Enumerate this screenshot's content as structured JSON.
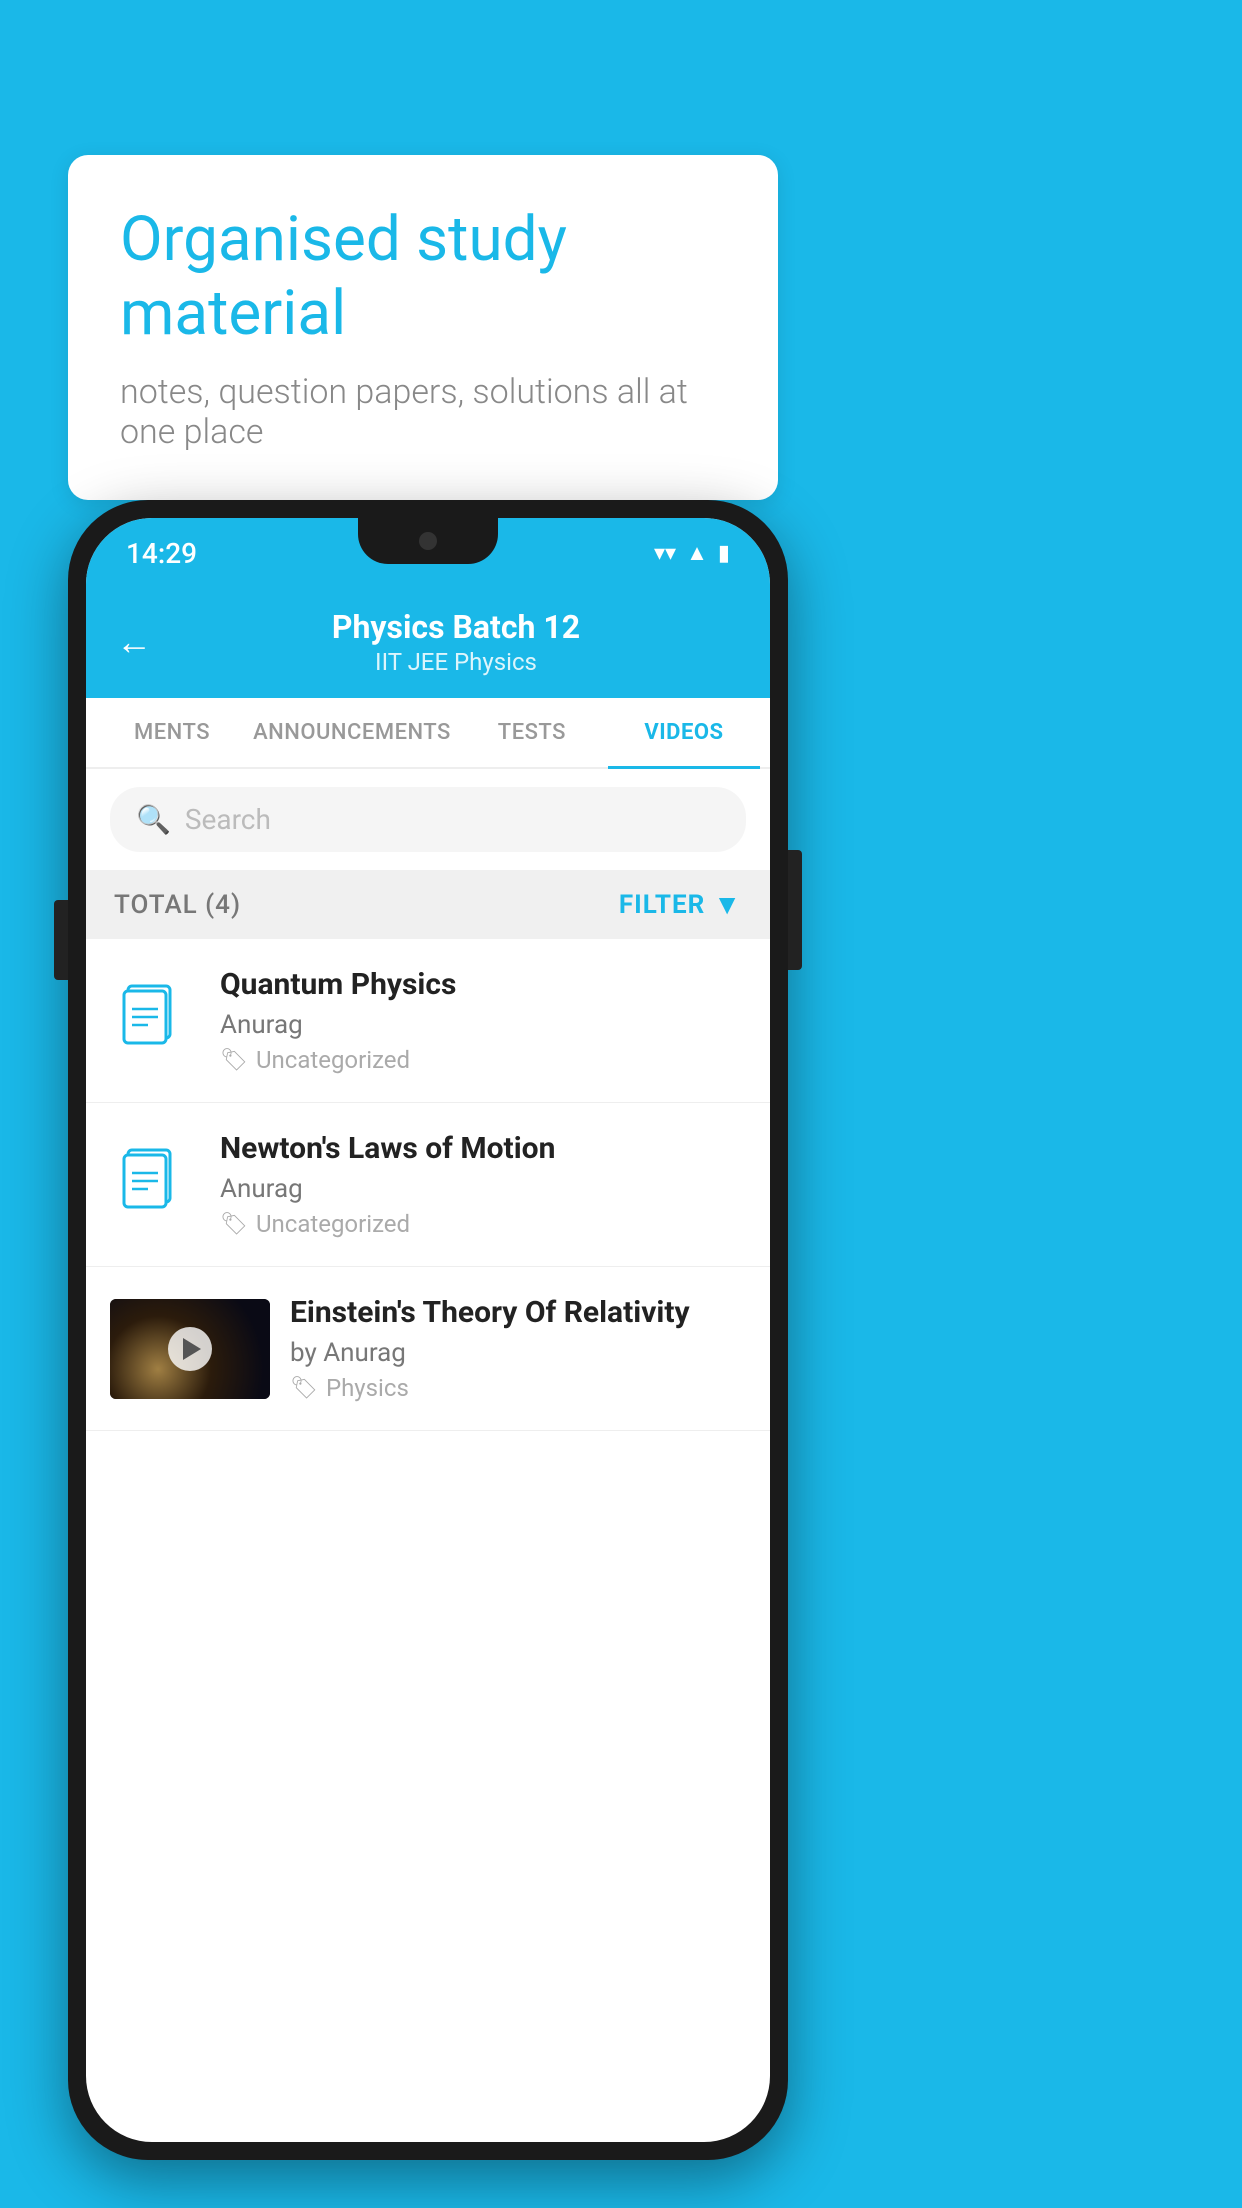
{
  "background_color": "#1ab8e8",
  "speech_bubble": {
    "headline": "Organised study material",
    "subtext": "notes, question papers, solutions all at one place"
  },
  "phone": {
    "status_bar": {
      "time": "14:29",
      "icons": [
        "wifi",
        "signal",
        "battery"
      ]
    },
    "header": {
      "back_label": "←",
      "title": "Physics Batch 12",
      "subtitle": "IIT JEE   Physics"
    },
    "tabs": [
      {
        "label": "MENTS",
        "active": false
      },
      {
        "label": "ANNOUNCEMENTS",
        "active": false
      },
      {
        "label": "TESTS",
        "active": false
      },
      {
        "label": "VIDEOS",
        "active": true
      }
    ],
    "search": {
      "placeholder": "Search"
    },
    "filter": {
      "total_label": "TOTAL (4)",
      "filter_label": "FILTER"
    },
    "videos": [
      {
        "id": 1,
        "title": "Quantum Physics",
        "author": "Anurag",
        "tag": "Uncategorized",
        "type": "file"
      },
      {
        "id": 2,
        "title": "Newton's Laws of Motion",
        "author": "Anurag",
        "tag": "Uncategorized",
        "type": "file"
      },
      {
        "id": 3,
        "title": "Einstein's Theory Of Relativity",
        "author": "by Anurag",
        "tag": "Physics",
        "type": "video"
      }
    ]
  }
}
